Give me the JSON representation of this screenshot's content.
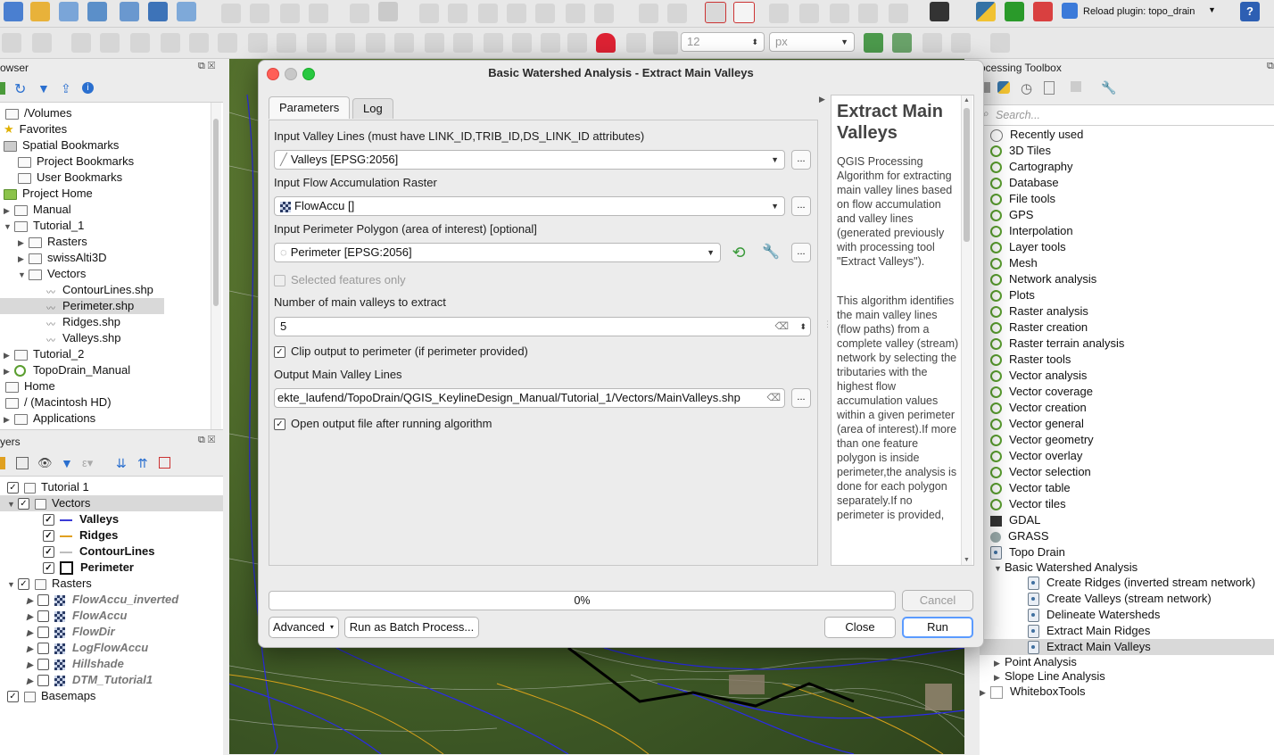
{
  "toolbar2": {
    "size_value": "12",
    "unit": "px"
  },
  "topbar": {
    "reload_plugin": "Reload plugin: topo_drain"
  },
  "browser": {
    "title": "owser",
    "items": [
      {
        "label": "/Volumes"
      },
      {
        "label": "Favorites"
      },
      {
        "label": "Spatial Bookmarks"
      },
      {
        "label": "Project Bookmarks"
      },
      {
        "label": "User Bookmarks"
      },
      {
        "label": "Project Home"
      },
      {
        "label": "Manual"
      },
      {
        "label": "Tutorial_1"
      },
      {
        "label": "Rasters"
      },
      {
        "label": "swissAlti3D"
      },
      {
        "label": "Vectors"
      },
      {
        "label": "ContourLines.shp"
      },
      {
        "label": "Perimeter.shp"
      },
      {
        "label": "Ridges.shp"
      },
      {
        "label": "Valleys.shp"
      },
      {
        "label": "Tutorial_2"
      },
      {
        "label": "TopoDrain_Manual"
      },
      {
        "label": "Home"
      },
      {
        "label": "/ (Macintosh HD)"
      },
      {
        "label": "Applications"
      }
    ]
  },
  "layers": {
    "title": "yers",
    "items": [
      {
        "label": "Tutorial 1"
      },
      {
        "label": "Vectors"
      },
      {
        "label": "Valleys"
      },
      {
        "label": "Ridges"
      },
      {
        "label": "ContourLines"
      },
      {
        "label": "Perimeter"
      },
      {
        "label": "Rasters"
      },
      {
        "label": "FlowAccu_inverted"
      },
      {
        "label": "FlowAccu"
      },
      {
        "label": "FlowDir"
      },
      {
        "label": "LogFlowAccu"
      },
      {
        "label": "Hillshade"
      },
      {
        "label": "DTM_Tutorial1"
      },
      {
        "label": "Basemaps"
      }
    ],
    "colors": {
      "valleys": "#3b3bd6",
      "ridges": "#e0a020",
      "contours": "#bdbdbd"
    }
  },
  "dialog": {
    "title": "Basic Watershed Analysis - Extract Main Valleys",
    "tabs": [
      "Parameters",
      "Log"
    ],
    "valley_label": "Input Valley Lines (must have LINK_ID,TRIB_ID,DS_LINK_ID attributes)",
    "valley_value": "Valleys [EPSG:2056]",
    "flow_label": "Input Flow Accumulation Raster",
    "flow_value": "FlowAccu []",
    "perimeter_label": "Input Perimeter Polygon (area of interest) [optional]",
    "perimeter_value": "Perimeter [EPSG:2056]",
    "selected_only": "Selected features only",
    "num_label": "Number of main valleys to extract",
    "num_value": "5",
    "clip_label": "Clip output to perimeter (if perimeter provided)",
    "output_label": "Output Main Valley Lines",
    "output_value": "ekte_laufend/TopoDrain/QGIS_KeylineDesign_Manual/Tutorial_1/Vectors/MainValleys.shp",
    "open_label": "Open output file after running algorithm",
    "ellipsis": "...",
    "progress": "0%",
    "cancel": "Cancel",
    "advanced": "Advanced",
    "batch": "Run as Batch Process...",
    "close": "Close",
    "run": "Run",
    "help_title": "Extract Main Valleys",
    "help_p1": "QGIS Processing Algorithm for extracting main valley lines based on flow accumulation and valley lines (generated previously with processing tool \"Extract Valleys\").",
    "help_p2": "This algorithm identifies the main valley lines (flow paths) from a complete valley (stream) network by selecting the tributaries with the highest flow accumulation values within a given perimeter (area of interest).If more than one feature polygon is inside perimeter,the analysis is done for each polygon separately.If no perimeter is provided,"
  },
  "toolbox": {
    "title": "ocessing Toolbox",
    "search_placeholder": "Search...",
    "groups": [
      {
        "label": "Recently used"
      },
      {
        "label": "3D Tiles"
      },
      {
        "label": "Cartography"
      },
      {
        "label": "Database"
      },
      {
        "label": "File tools"
      },
      {
        "label": "GPS"
      },
      {
        "label": "Interpolation"
      },
      {
        "label": "Layer tools"
      },
      {
        "label": "Mesh"
      },
      {
        "label": "Network analysis"
      },
      {
        "label": "Plots"
      },
      {
        "label": "Raster analysis"
      },
      {
        "label": "Raster creation"
      },
      {
        "label": "Raster terrain analysis"
      },
      {
        "label": "Raster tools"
      },
      {
        "label": "Vector analysis"
      },
      {
        "label": "Vector coverage"
      },
      {
        "label": "Vector creation"
      },
      {
        "label": "Vector general"
      },
      {
        "label": "Vector geometry"
      },
      {
        "label": "Vector overlay"
      },
      {
        "label": "Vector selection"
      },
      {
        "label": "Vector table"
      },
      {
        "label": "Vector tiles"
      },
      {
        "label": "GDAL"
      },
      {
        "label": "GRASS"
      },
      {
        "label": "Topo Drain"
      },
      {
        "label": "Basic Watershed Analysis"
      },
      {
        "label": "Create Ridges (inverted stream network)"
      },
      {
        "label": "Create Valleys (stream network)"
      },
      {
        "label": "Delineate Watersheds"
      },
      {
        "label": "Extract Main Ridges"
      },
      {
        "label": "Extract Main Valleys"
      },
      {
        "label": "Point Analysis"
      },
      {
        "label": "Slope Line Analysis"
      },
      {
        "label": "WhiteboxTools"
      }
    ]
  }
}
